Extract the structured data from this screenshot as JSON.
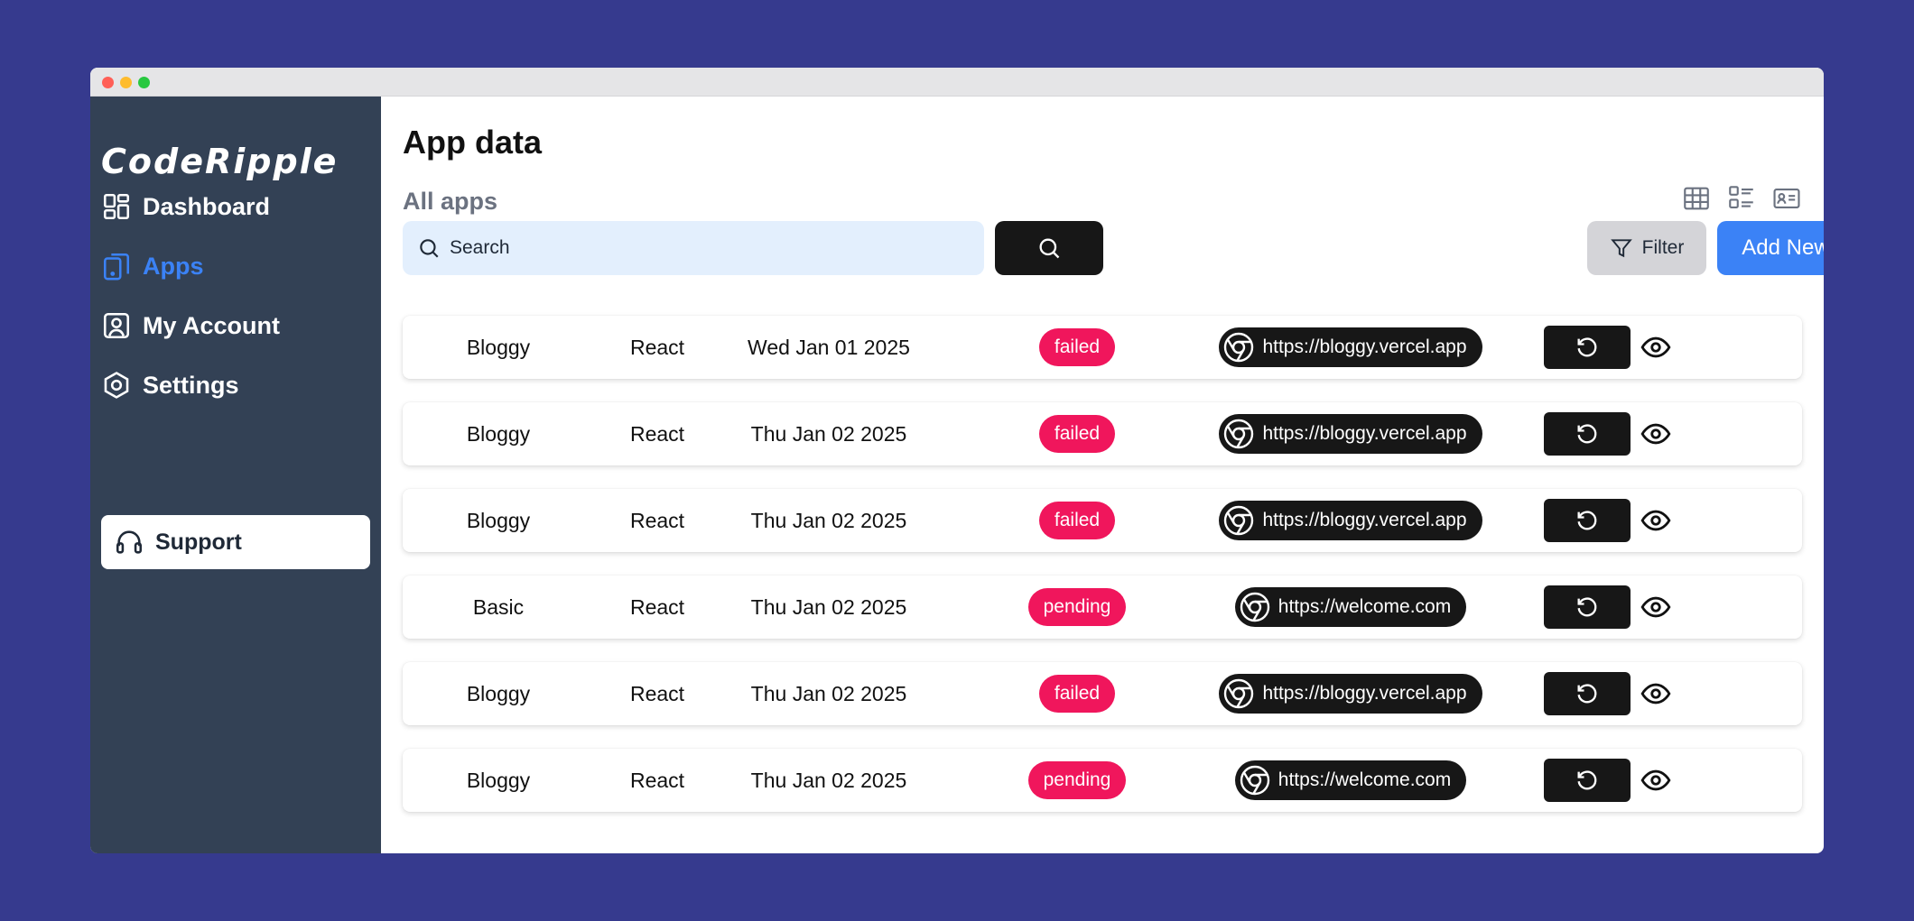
{
  "brand": {
    "logo_text": "CodeRipple"
  },
  "sidebar": {
    "items": [
      {
        "label": "Dashboard",
        "icon": "dashboard-icon",
        "active": false
      },
      {
        "label": "Apps",
        "icon": "tablet-icon",
        "active": true
      },
      {
        "label": "My Account",
        "icon": "user-square-icon",
        "active": false
      },
      {
        "label": "Settings",
        "icon": "hexagon-settings-icon",
        "active": false
      }
    ],
    "support_label": "Support"
  },
  "header": {
    "title": "App data",
    "section_title": "All apps"
  },
  "toolbar": {
    "search_placeholder": "Search",
    "search_value": "",
    "filter_label": "Filter",
    "add_label": "Add New",
    "view_modes": [
      "table-view-icon",
      "list-view-icon",
      "card-view-icon"
    ]
  },
  "colors": {
    "background": "#363a8e",
    "sidebar": "#334155",
    "accent": "#3b82f6",
    "status_badge": "#f0165c",
    "dark_button": "#171717",
    "search_bg": "#e3effd"
  },
  "apps": [
    {
      "name": "Bloggy",
      "framework": "React",
      "date": "Wed Jan 01 2025",
      "status": "failed",
      "url": "https://bloggy.vercel.app"
    },
    {
      "name": "Bloggy",
      "framework": "React",
      "date": "Thu Jan 02 2025",
      "status": "failed",
      "url": "https://bloggy.vercel.app"
    },
    {
      "name": "Bloggy",
      "framework": "React",
      "date": "Thu Jan 02 2025",
      "status": "failed",
      "url": "https://bloggy.vercel.app"
    },
    {
      "name": "Basic",
      "framework": "React",
      "date": "Thu Jan 02 2025",
      "status": "pending",
      "url": "https://welcome.com"
    },
    {
      "name": "Bloggy",
      "framework": "React",
      "date": "Thu Jan 02 2025",
      "status": "failed",
      "url": "https://bloggy.vercel.app"
    },
    {
      "name": "Bloggy",
      "framework": "React",
      "date": "Thu Jan 02 2025",
      "status": "pending",
      "url": "https://welcome.com"
    }
  ]
}
